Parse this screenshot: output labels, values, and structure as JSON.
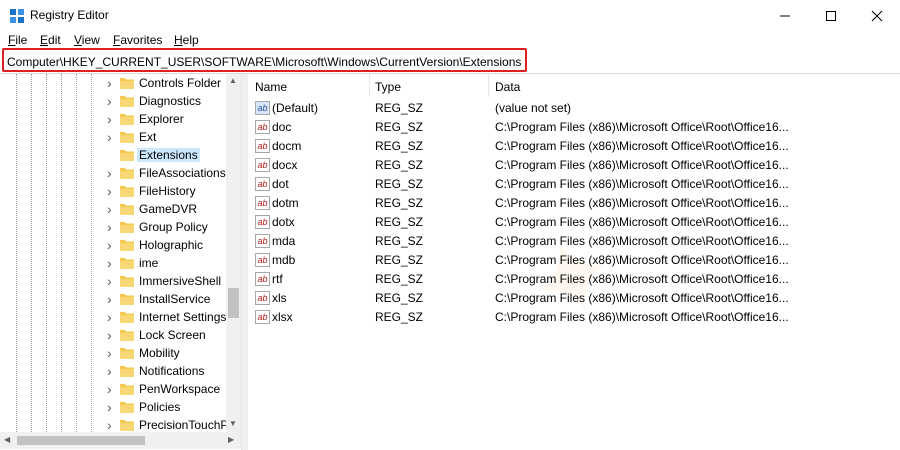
{
  "window": {
    "title": "Registry Editor"
  },
  "menu": [
    {
      "underline": "F",
      "rest": "ile"
    },
    {
      "underline": "E",
      "rest": "dit"
    },
    {
      "underline": "V",
      "rest": "iew"
    },
    {
      "underline": "F",
      "rest": "avorites"
    },
    {
      "underline": "H",
      "rest": "elp"
    }
  ],
  "address": "Computer\\HKEY_CURRENT_USER\\SOFTWARE\\Microsoft\\Windows\\CurrentVersion\\Extensions",
  "tree": [
    "Controls Folder",
    "Diagnostics",
    "Explorer",
    "Ext",
    "Extensions",
    "FileAssociations",
    "FileHistory",
    "GameDVR",
    "Group Policy",
    "Holographic",
    "ime",
    "ImmersiveShell",
    "InstallService",
    "Internet Settings",
    "Lock Screen",
    "Mobility",
    "Notifications",
    "PenWorkspace",
    "Policies",
    "PrecisionTouchP"
  ],
  "columns": {
    "name": "Name",
    "type": "Type",
    "data": "Data"
  },
  "values": [
    {
      "name": "(Default)",
      "type": "REG_SZ",
      "data": "(value not set)"
    },
    {
      "name": "doc",
      "type": "REG_SZ",
      "data": "C:\\Program Files (x86)\\Microsoft Office\\Root\\Office16..."
    },
    {
      "name": "docm",
      "type": "REG_SZ",
      "data": "C:\\Program Files (x86)\\Microsoft Office\\Root\\Office16..."
    },
    {
      "name": "docx",
      "type": "REG_SZ",
      "data": "C:\\Program Files (x86)\\Microsoft Office\\Root\\Office16..."
    },
    {
      "name": "dot",
      "type": "REG_SZ",
      "data": "C:\\Program Files (x86)\\Microsoft Office\\Root\\Office16..."
    },
    {
      "name": "dotm",
      "type": "REG_SZ",
      "data": "C:\\Program Files (x86)\\Microsoft Office\\Root\\Office16..."
    },
    {
      "name": "dotx",
      "type": "REG_SZ",
      "data": "C:\\Program Files (x86)\\Microsoft Office\\Root\\Office16..."
    },
    {
      "name": "mda",
      "type": "REG_SZ",
      "data": "C:\\Program Files (x86)\\Microsoft Office\\Root\\Office16..."
    },
    {
      "name": "mdb",
      "type": "REG_SZ",
      "data": "C:\\Program Files (x86)\\Microsoft Office\\Root\\Office16..."
    },
    {
      "name": "rtf",
      "type": "REG_SZ",
      "data": "C:\\Program Files (x86)\\Microsoft Office\\Root\\Office16..."
    },
    {
      "name": "xls",
      "type": "REG_SZ",
      "data": "C:\\Program Files (x86)\\Microsoft Office\\Root\\Office16..."
    },
    {
      "name": "xlsx",
      "type": "REG_SZ",
      "data": "C:\\Program Files (x86)\\Microsoft Office\\Root\\Office16..."
    }
  ],
  "icons": {
    "value_string": "ab",
    "minimize": "minimize-icon",
    "maximize": "maximize-icon",
    "close": "close-icon",
    "expand": "chevron-right-icon",
    "folder": "folder-icon"
  },
  "colors": {
    "highlight_border": "#e02020",
    "folder": "#f5c94e",
    "selection": "#cce8ff"
  }
}
